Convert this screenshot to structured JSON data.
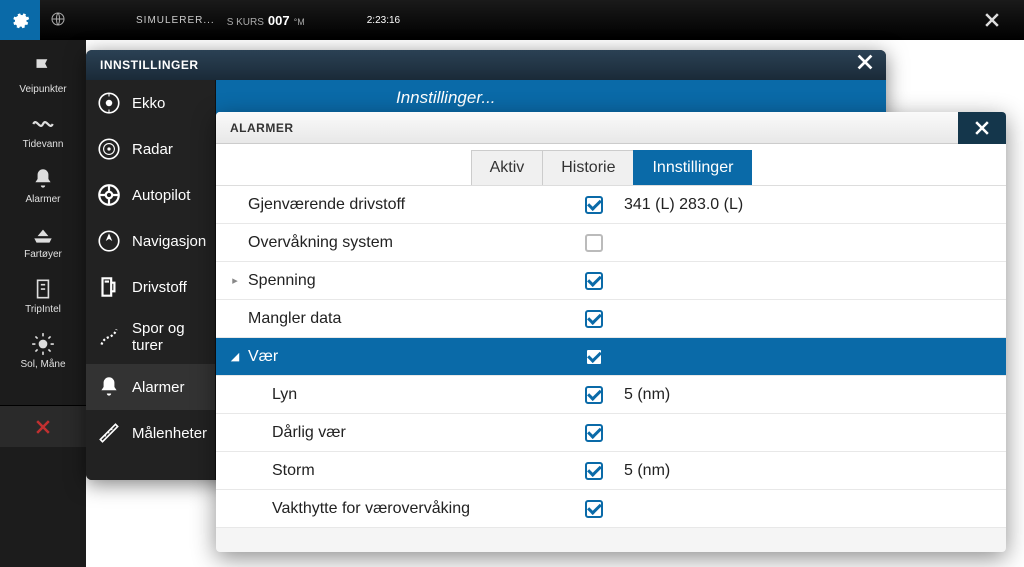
{
  "statusbar": {
    "sim": "SIMULERER...",
    "kurs_label": "S KURS",
    "kurs_value": "007",
    "kurs_unit": "°M",
    "time": "2:23:16"
  },
  "rail": [
    {
      "icon": "flag",
      "label": "Veipunkter"
    },
    {
      "icon": "wave",
      "label": "Tidevann"
    },
    {
      "icon": "bell",
      "label": "Alarmer"
    },
    {
      "icon": "boat",
      "label": "Fartøyer"
    },
    {
      "icon": "compass",
      "label": "TripIntel"
    },
    {
      "icon": "sun",
      "label": "Sol, Måne"
    }
  ],
  "win1": {
    "title": "INNSTILLINGER",
    "tab": "Innstillinger...",
    "items": [
      {
        "icon": "sonar",
        "label": "Ekko"
      },
      {
        "icon": "radar",
        "label": "Radar"
      },
      {
        "icon": "wheel",
        "label": "Autopilot"
      },
      {
        "icon": "nav",
        "label": "Navigasjon"
      },
      {
        "icon": "fuel",
        "label": "Drivstoff"
      },
      {
        "icon": "track",
        "label": "Spor og turer"
      },
      {
        "icon": "bell",
        "label": "Alarmer"
      },
      {
        "icon": "ruler",
        "label": "Målenheter"
      }
    ]
  },
  "win2": {
    "title": "ALARMER",
    "tabs": {
      "aktiv": "Aktiv",
      "historie": "Historie",
      "innst": "Innstillinger"
    },
    "rows": [
      {
        "tree": "",
        "label": "Gjenværende drivstoff",
        "checked": true,
        "value": "341 (L)  283.0 (L)",
        "indent": false
      },
      {
        "tree": "",
        "label": "Overvåkning system",
        "checked": false,
        "value": "",
        "indent": false
      },
      {
        "tree": "▸",
        "label": "Spenning",
        "checked": true,
        "value": "",
        "indent": false
      },
      {
        "tree": "",
        "label": "Mangler data",
        "checked": true,
        "value": "",
        "indent": false
      },
      {
        "tree": "◢",
        "label": "Vær",
        "checked": true,
        "value": "",
        "indent": false,
        "expanded": true
      },
      {
        "tree": "",
        "label": "Lyn",
        "checked": true,
        "value": "5 (nm)",
        "indent": true
      },
      {
        "tree": "",
        "label": "Dårlig vær",
        "checked": true,
        "value": "",
        "indent": true
      },
      {
        "tree": "",
        "label": "Storm",
        "checked": true,
        "value": "5 (nm)",
        "indent": true
      },
      {
        "tree": "",
        "label": "Vakthytte for værovervåking",
        "checked": true,
        "value": "",
        "indent": true
      }
    ]
  }
}
